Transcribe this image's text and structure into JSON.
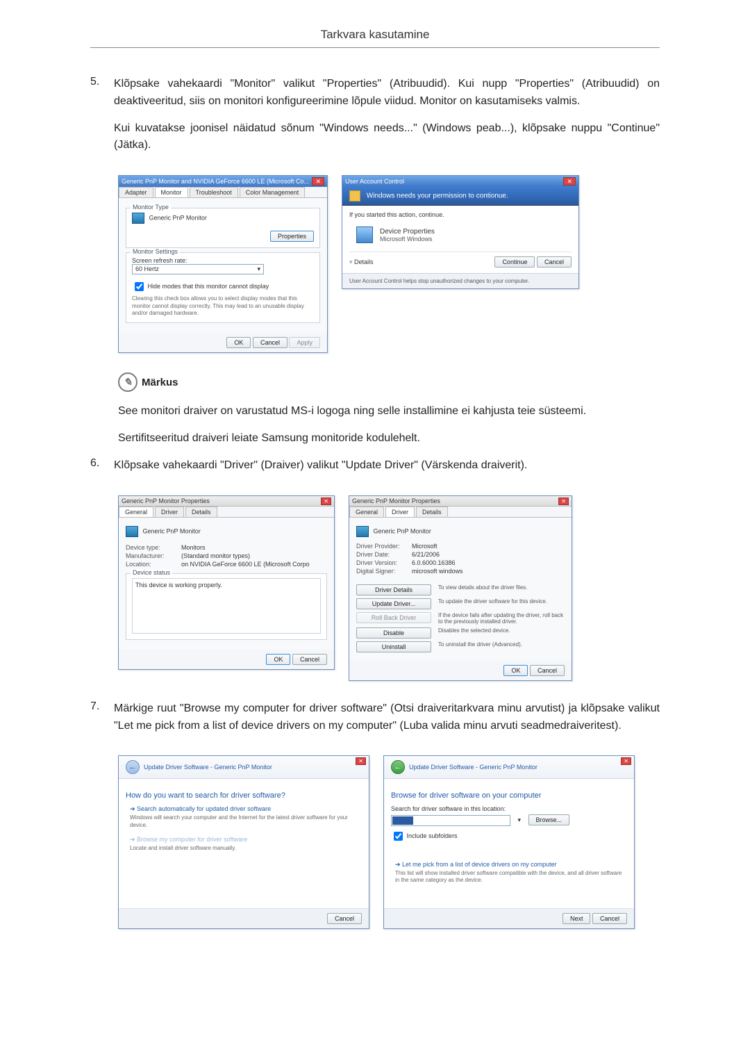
{
  "header": {
    "title": "Tarkvara kasutamine"
  },
  "step5": {
    "num": "5.",
    "para1": "Klõpsake vahekaardi \"Monitor\" valikut \"Properties\" (Atribuudid). Kui nupp \"Properties\" (Atribuudid) on deaktiveeritud, siis on monitori konfigureerimine lõpule viidud. Monitor on kasutamiseks valmis.",
    "para2": "Kui kuvatakse joonisel näidatud sõnum \"Windows needs...\" (Windows peab...), klõpsake nuppu \"Continue\" (Jätka)."
  },
  "monitorDlg": {
    "title": "Generic PnP Monitor and NVIDIA GeForce 6600 LE (Microsoft Co...",
    "tabs": [
      "Adapter",
      "Monitor",
      "Troubleshoot",
      "Color Management"
    ],
    "typeLegend": "Monitor Type",
    "typeName": "Generic PnP Monitor",
    "propBtn": "Properties",
    "settingsLegend": "Monitor Settings",
    "refreshLabel": "Screen refresh rate:",
    "refreshValue": "60 Hertz",
    "hideModes": "Hide modes that this monitor cannot display",
    "hideDesc": "Clearing this check box allows you to select display modes that this monitor cannot display correctly. This may lead to an unusable display and/or damaged hardware.",
    "ok": "OK",
    "cancel": "Cancel",
    "apply": "Apply"
  },
  "uac": {
    "title": "User Account Control",
    "stripe": "Windows needs your permission to contionue.",
    "ifStarted": "If you started this action, continue.",
    "devProp": "Device Properties",
    "msWin": "Microsoft Windows",
    "details": "Details",
    "continue": "Continue",
    "cancel": "Cancel",
    "footer": "User Account Control helps stop unauthorized changes to your computer."
  },
  "note": {
    "label": "Märkus",
    "p1": "See monitori draiver on varustatud MS-i logoga ning selle installimine ei kahjusta teie süsteemi.",
    "p2": "Sertifitseeritud draiveri leiate Samsung monitoride kodulehelt."
  },
  "step6": {
    "num": "6.",
    "text": "Klõpsake vahekaardi \"Driver\" (Draiver) valikut \"Update Driver\" (Värskenda draiverit)."
  },
  "genProps": {
    "title": "Generic PnP Monitor Properties",
    "tabs": [
      "General",
      "Driver",
      "Details"
    ],
    "name": "Generic PnP Monitor",
    "devTypeK": "Device type:",
    "devTypeV": "Monitors",
    "mfrK": "Manufacturer:",
    "mfrV": "(Standard monitor types)",
    "locK": "Location:",
    "locV": "on NVIDIA GeForce 6600 LE (Microsoft Corpo",
    "statusLegend": "Device status",
    "statusText": "This device is working properly.",
    "ok": "OK",
    "cancel": "Cancel"
  },
  "drvProps": {
    "title": "Generic PnP Monitor Properties",
    "tabs": [
      "General",
      "Driver",
      "Details"
    ],
    "name": "Generic PnP Monitor",
    "provK": "Driver Provider:",
    "provV": "Microsoft",
    "dateK": "Driver Date:",
    "dateV": "6/21/2006",
    "verK": "Driver Version:",
    "verV": "6.0.6000.16386",
    "signK": "Digital Signer:",
    "signV": "microsoft windows",
    "btnDetails": "Driver Details",
    "descDetails": "To view details about the driver files.",
    "btnUpdate": "Update Driver...",
    "descUpdate": "To update the driver software for this device.",
    "btnRoll": "Roll Back Driver",
    "descRoll": "If the device fails after updating the driver, roll back to the previously installed driver.",
    "btnDisable": "Disable",
    "descDisable": "Disables the selected device.",
    "btnUninst": "Uninstall",
    "descUninst": "To uninstall the driver (Advanced).",
    "ok": "OK",
    "cancel": "Cancel"
  },
  "step7": {
    "num": "7.",
    "text": "Märkige ruut \"Browse my computer for driver software\" (Otsi draiveritarkvara minu arvutist) ja klõpsake valikut \"Let me pick from a list of device drivers on my computer\" (Luba valida minu arvuti seadmedraiveritest)."
  },
  "wiz1": {
    "crumb": "Update Driver Software - Generic PnP Monitor",
    "heading": "How do you want to search for driver software?",
    "opt1": "Search automatically for updated driver software",
    "opt1sub": "Windows will search your computer and the Internet for the latest driver software for your device.",
    "opt2": "Browse my computer for driver software",
    "opt2sub": "Locate and install driver software manually.",
    "cancel": "Cancel"
  },
  "wiz2": {
    "crumb": "Update Driver Software - Generic PnP Monitor",
    "heading": "Browse for driver software on your computer",
    "searchLabel": "Search for driver software in this location:",
    "browse": "Browse...",
    "include": "Include subfolders",
    "opt": "Let me pick from a list of device drivers on my computer",
    "optsub": "This list will show installed driver software compatible with the device, and all driver software in the same category as the device.",
    "next": "Next",
    "cancel": "Cancel"
  }
}
